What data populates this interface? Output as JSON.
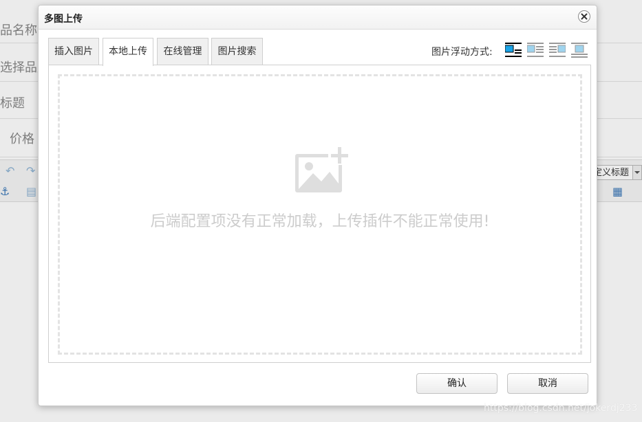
{
  "background": {
    "labels": [
      "品名称",
      "选择品牌",
      "标题",
      "价格"
    ],
    "heading_select": "定义标题"
  },
  "dialog": {
    "title": "多图上传",
    "tabs": [
      {
        "label": "插入图片",
        "active": false
      },
      {
        "label": "本地上传",
        "active": true
      },
      {
        "label": "在线管理",
        "active": false
      },
      {
        "label": "图片搜索",
        "active": false
      }
    ],
    "float_label": "图片浮动方式:",
    "float_options": [
      "none",
      "left",
      "right",
      "center"
    ],
    "selected_float": "none",
    "message": "后端配置项没有正常加载，上传插件不能正常使用!",
    "confirm_label": "确认",
    "cancel_label": "取消"
  },
  "watermark": "https://blog.csdn.net/jokerdj233",
  "colors": {
    "accent_blue": "#1aa3e6",
    "placeholder_gray": "#cccccc"
  }
}
